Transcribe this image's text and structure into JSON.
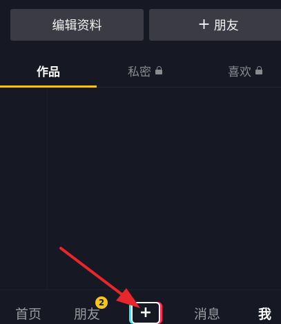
{
  "actions": {
    "edit_profile": "编辑资料",
    "add_friend_plus": "+",
    "add_friend": "朋友"
  },
  "tabs": [
    {
      "label": "作品",
      "active": true
    },
    {
      "label": "私密",
      "locked": true
    },
    {
      "label": "喜欢",
      "locked": true
    }
  ],
  "bottom_nav": {
    "home": "首页",
    "friends": "朋友",
    "friends_badge": "2",
    "create": "+",
    "messages": "消息",
    "me": "我"
  },
  "colors": {
    "background": "#161823",
    "button_bg": "#3a3b44",
    "accent_yellow": "#f5c518",
    "arrow_red": "#e8262b",
    "brand_cyan": "#25f4ee",
    "brand_red": "#fe2c55"
  }
}
